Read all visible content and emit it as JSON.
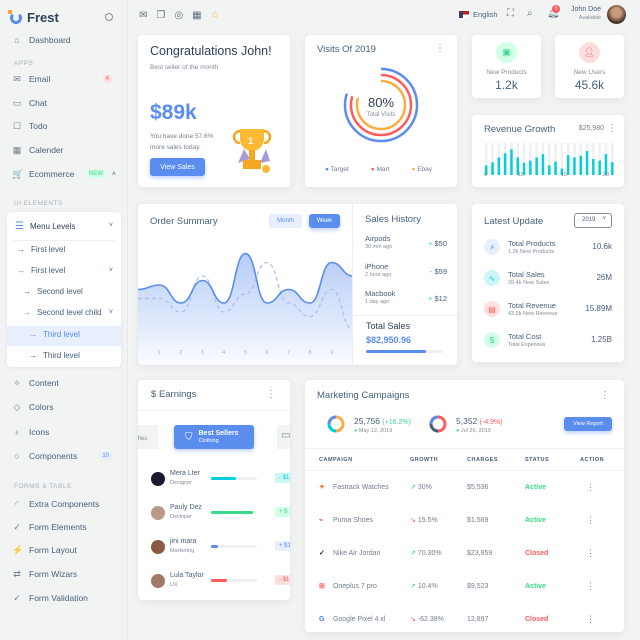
{
  "brand": {
    "name": "Frest"
  },
  "sidebar": {
    "dashboard": "Dashboard",
    "apps_header": "APPS",
    "apps": [
      {
        "label": "Email",
        "badge": "4"
      },
      {
        "label": "Chat"
      },
      {
        "label": "Todo"
      },
      {
        "label": "Calender"
      },
      {
        "label": "Ecommerce",
        "badge": "NEW"
      }
    ],
    "ui_header": "UI ELEMENTS",
    "menu_levels": {
      "label": "Menu Levels",
      "items": [
        "First level",
        "First level",
        "Second level",
        "Second level child",
        "Third level",
        "Third level"
      ]
    },
    "ui_items": [
      {
        "label": "Content"
      },
      {
        "label": "Colors"
      },
      {
        "label": "Icons"
      },
      {
        "label": "Components",
        "badge": "10"
      }
    ],
    "forms_header": "FORMS & TABLE",
    "forms": [
      "Extra Components",
      "Form Elements",
      "Form Layout",
      "Form Wizars",
      "Form Validation"
    ]
  },
  "topbar": {
    "language": "English",
    "notifications": "5",
    "user_name": "John Doe",
    "user_status": "Available"
  },
  "congrats": {
    "title": "Congratulations John!",
    "subtitle": "Best seller of the month",
    "amount": "$89k",
    "text1": "You have done 57.6%",
    "text2": "more sales today.",
    "button": "View Sales"
  },
  "visits": {
    "title": "Visits Of 2019",
    "value": "80%",
    "label": "Total Visits",
    "legend": [
      {
        "name": "Target",
        "color": "#5a8dee"
      },
      {
        "name": "Mart",
        "color": "#ff5b5c"
      },
      {
        "name": "Ebay",
        "color": "#fdac41"
      }
    ]
  },
  "stats": [
    {
      "label": "New Products",
      "value": "1.2k",
      "color": "#39da8a"
    },
    {
      "label": "New Users",
      "value": "45.6k",
      "color": "#ff5b5c"
    }
  ],
  "revenue": {
    "title": "Revenue Growth",
    "amount": "$25,980",
    "ticks": [
      "0",
      "10",
      "15",
      "20"
    ],
    "bars": [
      30,
      40,
      55,
      68,
      80,
      55,
      38,
      45,
      55,
      65,
      30,
      42,
      20,
      62,
      55,
      60,
      75,
      50,
      45,
      65,
      40
    ]
  },
  "order_summary": {
    "title": "Order Summary",
    "tabs": [
      "Month",
      "Week"
    ],
    "active_tab": "Week",
    "x_labels": [
      "1",
      "2",
      "3",
      "4",
      "5",
      "6",
      "7",
      "8",
      "9"
    ],
    "series_solid": [
      55,
      60,
      40,
      65,
      40,
      95,
      40,
      55,
      40,
      85,
      70
    ],
    "series_dashed": [
      45,
      45,
      30,
      70,
      30,
      50,
      85,
      40,
      25,
      55,
      10
    ]
  },
  "sales_history": {
    "title": "Sales History",
    "items": [
      {
        "name": "Airpods",
        "time": "30 min ago",
        "sign": "+",
        "value": "$50"
      },
      {
        "name": "iPhone",
        "time": "2 hour ago",
        "sign": "-",
        "value": "$59"
      },
      {
        "name": "Macbook",
        "time": "1 day ago",
        "sign": "+",
        "value": "$12"
      }
    ],
    "total_label": "Total Sales",
    "total": "$82,950.96",
    "progress": 0.78
  },
  "latest_update": {
    "title": "Latest Update",
    "year": "2019",
    "items": [
      {
        "title": "Total Products",
        "sub": "1.2k New Products",
        "value": "10.6k",
        "icon": "bolt-icon",
        "color": "#5a8dee"
      },
      {
        "title": "Total Sales",
        "sub": "39.4k New Sales",
        "value": "26M",
        "icon": "pulse-icon",
        "color": "#00cfdd"
      },
      {
        "title": "Total Revenue",
        "sub": "43.5k New Revenue",
        "value": "15.89M",
        "icon": "credit-card-icon",
        "color": "#ff5b5c"
      },
      {
        "title": "Total Cost",
        "sub": "Total Expenses",
        "value": "1.25B",
        "icon": "dollar-icon",
        "color": "#39da8a"
      }
    ]
  },
  "earnings": {
    "title": "Earnings",
    "prev_tab": "thes",
    "active_tab": {
      "title": "Best Sellers",
      "sub": "Clothing"
    },
    "people": [
      {
        "name": "Mera Lter",
        "role": "Designer",
        "progress": 0.55,
        "color": "#00cfdd",
        "amount": "- $1"
      },
      {
        "name": "Pauly Dez",
        "role": "Devloper",
        "progress": 0.92,
        "color": "#39da8a",
        "amount": "+ $"
      },
      {
        "name": "jini mara",
        "role": "Marketing",
        "progress": 0.15,
        "color": "#5a8dee",
        "amount": "+ $1"
      },
      {
        "name": "Lula Taylor",
        "role": "UX",
        "progress": 0.35,
        "color": "#ff5b5c",
        "amount": "- $1"
      }
    ]
  },
  "marketing": {
    "title": "Marketing Campaigns",
    "summary": [
      {
        "value": "25,756",
        "change": "(+16.2%)",
        "date": "May 12, 2019",
        "trend": "up"
      },
      {
        "value": "5,352",
        "change": "(-4.9%)",
        "date": "Jul 26, 2019",
        "trend": "down"
      }
    ],
    "button": "View Report",
    "columns": [
      "CAMPAIGN",
      "GROWTH",
      "CHARGES",
      "STATUS",
      "ACTION"
    ],
    "rows": [
      {
        "name": "Fastrack Watches",
        "growth": "30%",
        "trend": "up",
        "charges": "$5,536",
        "status": "Active"
      },
      {
        "name": "Puma Shoes",
        "growth": "15.5%",
        "trend": "down",
        "charges": "$1,569",
        "status": "Active"
      },
      {
        "name": "Nike Air Jordan",
        "growth": "70.30%",
        "trend": "up",
        "charges": "$23,859",
        "status": "Closed"
      },
      {
        "name": "Oneplus 7 pro",
        "growth": "10.4%",
        "trend": "up",
        "charges": "$9,523",
        "status": "Active"
      },
      {
        "name": "Google Pixel 4 xl",
        "growth": "-62.38%",
        "trend": "down",
        "charges": "12,897",
        "status": "Closed"
      }
    ]
  }
}
